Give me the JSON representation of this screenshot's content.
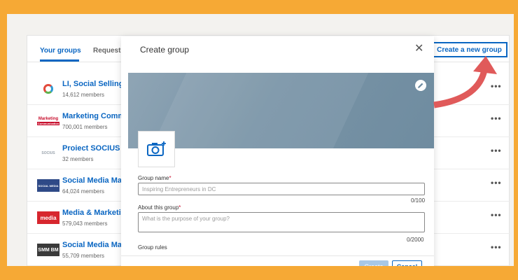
{
  "tabs": [
    {
      "label": "Your groups",
      "active": true
    },
    {
      "label": "Requested",
      "active": false
    }
  ],
  "create_group_button": "Create a new group",
  "groups": [
    {
      "name": "LI, Social Selling, S",
      "members": "14,612 members",
      "logo_text": ""
    },
    {
      "name": "Marketing Commu",
      "members": "700,001 members",
      "logo_text": "Marketing",
      "logo_subtext": "Communication"
    },
    {
      "name": "Proiect SOCIUS",
      "members": "32 members",
      "logo_text": "SOCIUS"
    },
    {
      "name": "Social Media Mark",
      "members": "64,024 members",
      "logo_text": "SOCIAL MEDIA"
    },
    {
      "name": "Media & Marketing",
      "members": "579,043 members",
      "logo_text": "media"
    },
    {
      "name": "Social Media Mark",
      "members": "55,709 members",
      "logo_text": "SMM BM"
    }
  ],
  "modal": {
    "title": "Create group",
    "group_name_label": "Group name",
    "group_name_value": "Inspiring Entrepreneurs in DC",
    "group_name_counter": "0/100",
    "about_label": "About this group",
    "about_placeholder": "What is the purpose of your group?",
    "about_counter": "0/2000",
    "rules_label": "Group rules",
    "required_marker": "*",
    "create_label": "Create",
    "cancel_label": "Cancel"
  },
  "icons": {
    "close": "close-icon",
    "edit": "pencil-icon",
    "camera": "camera-add-icon",
    "more": "more-horizontal-icon",
    "arrow": "curved-arrow-annotation"
  },
  "colors": {
    "frame": "#f6a935",
    "linkedin_blue": "#0a66c2",
    "arrow": "#e05a5a"
  }
}
